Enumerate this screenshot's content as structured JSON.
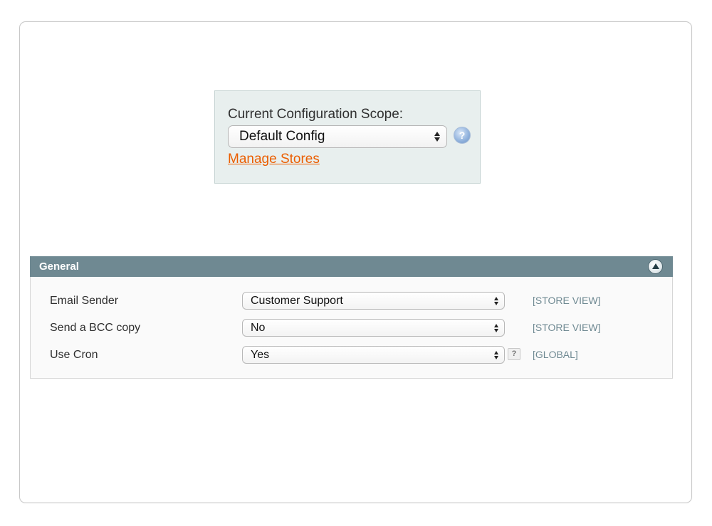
{
  "scope_switcher": {
    "title": "Current Configuration Scope:",
    "selected": "Default Config",
    "help_icon": "help-icon",
    "manage_link": "Manage Stores"
  },
  "section": {
    "title": "General",
    "collapse_icon": "collapse-up-icon",
    "rows": [
      {
        "label": "Email Sender",
        "value": "Customer Support",
        "scope": "[STORE VIEW]",
        "help": ""
      },
      {
        "label": "Send a BCC copy",
        "value": "No",
        "scope": "[STORE VIEW]",
        "help": ""
      },
      {
        "label": "Use Cron",
        "value": "Yes",
        "scope": "[GLOBAL]",
        "help": "?"
      }
    ]
  },
  "colors": {
    "link_orange": "#eb5e00",
    "section_header": "#6f8992",
    "scope_box_bg": "#e8efee"
  }
}
